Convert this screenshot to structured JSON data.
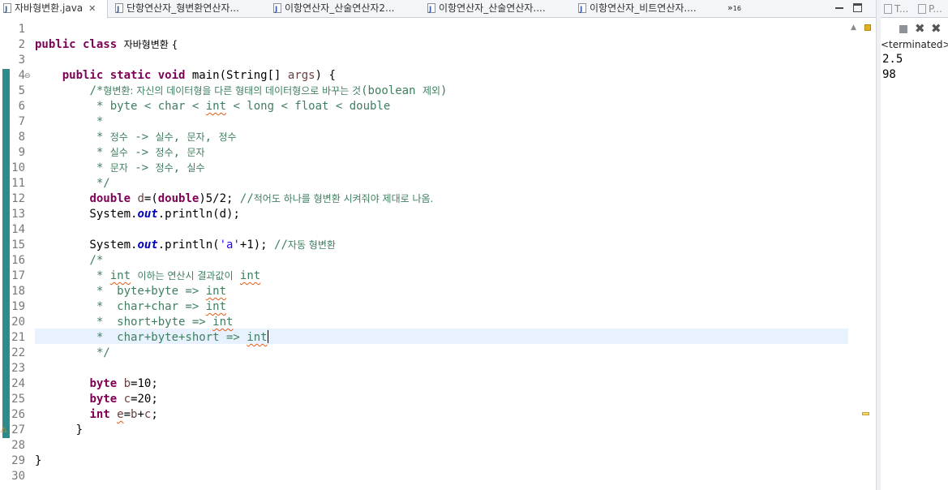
{
  "editor_tabs": [
    {
      "label": "자바형변환.java",
      "active": true
    },
    {
      "label": "단항연산자_형변환연산자...",
      "active": false
    },
    {
      "label": "이항연산자_산술연산자2...",
      "active": false
    },
    {
      "label": "이항연산자_산술연산자....",
      "active": false
    },
    {
      "label": "이항연산자_비트연산자....",
      "active": false
    }
  ],
  "tab_overflow": {
    "symbol": "»",
    "count": "16"
  },
  "line_numbers": [
    "1",
    "2",
    "3",
    "4",
    "5",
    "6",
    "7",
    "8",
    "9",
    "10",
    "11",
    "12",
    "13",
    "14",
    "15",
    "16",
    "17",
    "18",
    "19",
    "20",
    "21",
    "22",
    "23",
    "24",
    "25",
    "26",
    "27",
    "28",
    "29",
    "30"
  ],
  "code_lines": [
    [],
    [
      {
        "t": "public class ",
        "c": "kw"
      },
      {
        "t": "자바형변환 {",
        "c": "ko"
      }
    ],
    [],
    [
      {
        "t": "    "
      },
      {
        "t": "public static void ",
        "c": "kw"
      },
      {
        "t": "main(String[] "
      },
      {
        "t": "args",
        "c": "loc"
      },
      {
        "t": ") {"
      }
    ],
    [
      {
        "t": "        "
      },
      {
        "t": "/*",
        "c": "cm"
      },
      {
        "t": "형변환: 자신의 데이터형을 다른 형태의 데이터형으로 바꾸는 것",
        "c": "cm ko"
      },
      {
        "t": "(boolean ",
        "c": "cm"
      },
      {
        "t": "제외",
        "c": "cm ko"
      },
      {
        "t": ")",
        "c": "cm"
      }
    ],
    [
      {
        "t": "         * byte < char < ",
        "c": "cm"
      },
      {
        "t": "int",
        "c": "cm sq"
      },
      {
        "t": " < long < float < double",
        "c": "cm"
      }
    ],
    [
      {
        "t": "         *",
        "c": "cm"
      }
    ],
    [
      {
        "t": "         * ",
        "c": "cm"
      },
      {
        "t": "정수",
        "c": "cm ko"
      },
      {
        "t": " -> ",
        "c": "cm"
      },
      {
        "t": "실수",
        "c": "cm ko"
      },
      {
        "t": ", ",
        "c": "cm"
      },
      {
        "t": "문자",
        "c": "cm ko"
      },
      {
        "t": ", ",
        "c": "cm"
      },
      {
        "t": "정수",
        "c": "cm ko"
      }
    ],
    [
      {
        "t": "         * ",
        "c": "cm"
      },
      {
        "t": "실수",
        "c": "cm ko"
      },
      {
        "t": " -> ",
        "c": "cm"
      },
      {
        "t": "정수",
        "c": "cm ko"
      },
      {
        "t": ", ",
        "c": "cm"
      },
      {
        "t": "문자",
        "c": "cm ko"
      }
    ],
    [
      {
        "t": "         * ",
        "c": "cm"
      },
      {
        "t": "문자",
        "c": "cm ko"
      },
      {
        "t": " -> ",
        "c": "cm"
      },
      {
        "t": "정수",
        "c": "cm ko"
      },
      {
        "t": ", ",
        "c": "cm"
      },
      {
        "t": "실수",
        "c": "cm ko"
      }
    ],
    [
      {
        "t": "         */",
        "c": "cm"
      }
    ],
    [
      {
        "t": "        "
      },
      {
        "t": "double ",
        "c": "kw"
      },
      {
        "t": "d",
        "c": "loc"
      },
      {
        "t": "=("
      },
      {
        "t": "double",
        "c": "kw"
      },
      {
        "t": ")5/2; "
      },
      {
        "t": "//",
        "c": "cm"
      },
      {
        "t": "적어도 하나를 형변환 시켜줘야 제대로 나옴.",
        "c": "cm ko"
      }
    ],
    [
      {
        "t": "        System."
      },
      {
        "t": "out",
        "c": "fld"
      },
      {
        "t": ".println(d);"
      }
    ],
    [],
    [
      {
        "t": "        System."
      },
      {
        "t": "out",
        "c": "fld"
      },
      {
        "t": ".println("
      },
      {
        "t": "'a'",
        "c": "st"
      },
      {
        "t": "+1); "
      },
      {
        "t": "//",
        "c": "cm"
      },
      {
        "t": "자동 형변환",
        "c": "cm ko"
      }
    ],
    [
      {
        "t": "        /*",
        "c": "cm"
      }
    ],
    [
      {
        "t": "         * ",
        "c": "cm"
      },
      {
        "t": "int",
        "c": "cm sq"
      },
      {
        "t": " ",
        "c": "cm"
      },
      {
        "t": "이하는 연산시 결과값이",
        "c": "cm ko"
      },
      {
        "t": " ",
        "c": "cm"
      },
      {
        "t": "int",
        "c": "cm sq"
      }
    ],
    [
      {
        "t": "         *  byte+byte => ",
        "c": "cm"
      },
      {
        "t": "int",
        "c": "cm sq"
      }
    ],
    [
      {
        "t": "         *  char+char => ",
        "c": "cm"
      },
      {
        "t": "int",
        "c": "cm sq"
      }
    ],
    [
      {
        "t": "         *  short+byte => ",
        "c": "cm"
      },
      {
        "t": "int",
        "c": "cm sq"
      }
    ],
    [
      {
        "t": "         *  char+byte+short => ",
        "c": "cm"
      },
      {
        "t": "int",
        "c": "cm sq"
      }
    ],
    [
      {
        "t": "         */",
        "c": "cm"
      }
    ],
    [],
    [
      {
        "t": "        "
      },
      {
        "t": "byte ",
        "c": "kw"
      },
      {
        "t": "b",
        "c": "loc"
      },
      {
        "t": "=10;"
      }
    ],
    [
      {
        "t": "        "
      },
      {
        "t": "byte ",
        "c": "kw"
      },
      {
        "t": "c",
        "c": "loc"
      },
      {
        "t": "=20;"
      }
    ],
    [
      {
        "t": "        "
      },
      {
        "t": "int ",
        "c": "kw"
      },
      {
        "t": "e",
        "c": "loc sq"
      },
      {
        "t": "="
      },
      {
        "t": "b",
        "c": "loc"
      },
      {
        "t": "+"
      },
      {
        "t": "c",
        "c": "loc"
      },
      {
        "t": ";"
      }
    ],
    [
      {
        "t": "      }"
      }
    ],
    [],
    [
      {
        "t": "}"
      }
    ],
    []
  ],
  "cursor": {
    "line": 21
  },
  "fold_icon": "fold-minus-icon",
  "console": {
    "tabs": [
      "T...",
      "P..."
    ],
    "status": "<terminated> 자",
    "output": [
      "2.5",
      "98"
    ]
  },
  "colors": {
    "keyword": "#7f0055",
    "comment": "#3f7f5f",
    "string": "#2a00ff",
    "field": "#0000c0",
    "current_line": "#e8f2fe",
    "quick_diff": "#2e8b8b"
  }
}
